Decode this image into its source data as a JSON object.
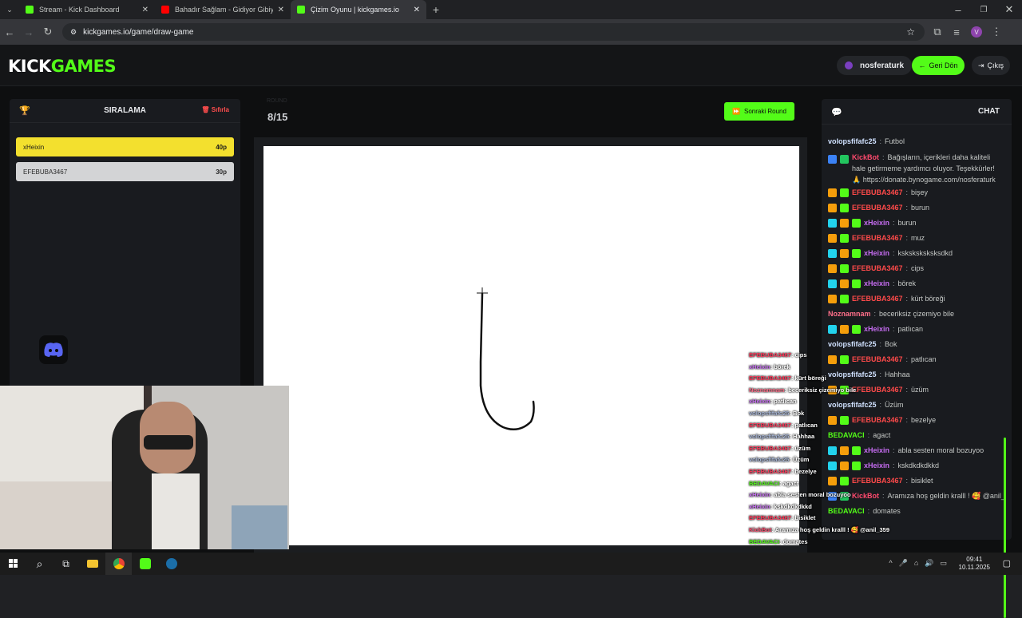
{
  "browser": {
    "tabs": [
      {
        "title": "Stream - Kick Dashboard",
        "color": "#53fc18"
      },
      {
        "title": "Bahadır Sağlam - Gidiyor Gibiyi",
        "color": "#ff0000"
      },
      {
        "title": "Çizim Oyunu | kickgames.io",
        "color": "#53fc18"
      }
    ],
    "url": "kickgames.io/game/draw-game",
    "profile_letter": "V"
  },
  "header": {
    "logo_kick": "KICK",
    "logo_games": "GAMES",
    "username": "nosferaturk",
    "back_label": "Geri Dön",
    "exit_label": "Çıkış"
  },
  "ranking": {
    "title": "SIRALAMA",
    "reset_label": "Sıfırla",
    "players": [
      {
        "name": "xHeixin",
        "points": "40p",
        "bg": "#f3e02e",
        "color": "#1a1a1a"
      },
      {
        "name": "EFEBUBA3467",
        "points": "30p",
        "bg": "#d3d4d6",
        "color": "#2a2a2a"
      }
    ]
  },
  "game": {
    "round_label": "ROUND",
    "round": "8/15",
    "next_round_label": "Sonraki Round"
  },
  "chat": {
    "title": "CHAT",
    "messages": [
      {
        "user": "volopsfifafc25",
        "text": "Futbol",
        "color": "#d0e1ff",
        "badges": []
      },
      {
        "user": "KickBot",
        "text": "Bağışların, içerikleri daha kaliteli hale getirmeme yardımcı oluyor. Teşekkürler! 🙏 https://donate.bynogame.com/nosferaturk",
        "color": "#ff4a6e",
        "badges": [
          "#3b82f6",
          "#22c55e"
        ]
      },
      {
        "user": "EFEBUBA3467",
        "text": "bişey",
        "color": "#ff4a4a",
        "badges": [
          "#f59e0b",
          "#53fc18"
        ]
      },
      {
        "user": "EFEBUBA3467",
        "text": "burun",
        "color": "#ff4a4a",
        "badges": [
          "#f59e0b",
          "#53fc18"
        ]
      },
      {
        "user": "xHeixin",
        "text": "burun",
        "color": "#c56cf0",
        "badges": [
          "#22d3ee",
          "#f59e0b",
          "#53fc18"
        ]
      },
      {
        "user": "EFEBUBA3467",
        "text": "muz",
        "color": "#ff4a4a",
        "badges": [
          "#f59e0b",
          "#53fc18"
        ]
      },
      {
        "user": "xHeixin",
        "text": "ksksksksksksdkd",
        "color": "#c56cf0",
        "badges": [
          "#22d3ee",
          "#f59e0b",
          "#53fc18"
        ]
      },
      {
        "user": "EFEBUBA3467",
        "text": "cips",
        "color": "#ff4a4a",
        "badges": [
          "#f59e0b",
          "#53fc18"
        ]
      },
      {
        "user": "xHeixin",
        "text": "börek",
        "color": "#c56cf0",
        "badges": [
          "#22d3ee",
          "#f59e0b",
          "#53fc18"
        ]
      },
      {
        "user": "EFEBUBA3467",
        "text": "kürt böreği",
        "color": "#ff4a4a",
        "badges": [
          "#f59e0b",
          "#53fc18"
        ]
      },
      {
        "user": "Noznamnam",
        "text": "beceriksiz çizemiyo bile",
        "color": "#ff6f8a",
        "badges": []
      },
      {
        "user": "xHeixin",
        "text": "patlıcan",
        "color": "#c56cf0",
        "badges": [
          "#22d3ee",
          "#f59e0b",
          "#53fc18"
        ]
      },
      {
        "user": "volopsfifafc25",
        "text": "Bok",
        "color": "#d0e1ff",
        "badges": []
      },
      {
        "user": "EFEBUBA3467",
        "text": "patlıcan",
        "color": "#ff4a4a",
        "badges": [
          "#f59e0b",
          "#53fc18"
        ]
      },
      {
        "user": "volopsfifafc25",
        "text": "Hahhaa",
        "color": "#d0e1ff",
        "badges": []
      },
      {
        "user": "EFEBUBA3467",
        "text": "üzüm",
        "color": "#ff4a4a",
        "badges": [
          "#f59e0b",
          "#53fc18"
        ]
      },
      {
        "user": "volopsfifafc25",
        "text": "Üzüm",
        "color": "#d0e1ff",
        "badges": []
      },
      {
        "user": "EFEBUBA3467",
        "text": "bezelye",
        "color": "#ff4a4a",
        "badges": [
          "#f59e0b",
          "#53fc18"
        ]
      },
      {
        "user": "BEDAVACI",
        "text": "agact",
        "color": "#53fc18",
        "badges": []
      },
      {
        "user": "xHeixin",
        "text": "abla sesten moral bozuyoo",
        "color": "#c56cf0",
        "badges": [
          "#22d3ee",
          "#f59e0b",
          "#53fc18"
        ]
      },
      {
        "user": "xHeixin",
        "text": "kskdkdkdkkd",
        "color": "#c56cf0",
        "badges": [
          "#22d3ee",
          "#f59e0b",
          "#53fc18"
        ]
      },
      {
        "user": "EFEBUBA3467",
        "text": "bisiklet",
        "color": "#ff4a4a",
        "badges": [
          "#f59e0b",
          "#53fc18"
        ]
      },
      {
        "user": "KickBot",
        "text": "Aramıza hoş geldin kralll ! 🥰 @anil_359",
        "color": "#ff4a6e",
        "badges": [
          "#3b82f6",
          "#22c55e"
        ]
      },
      {
        "user": "BEDAVACI",
        "text": "domates",
        "color": "#53fc18",
        "badges": []
      }
    ]
  },
  "overlay": {
    "messages": [
      {
        "user": "EFEBUBA3467",
        "text": "cips",
        "color": "#ff3b5c"
      },
      {
        "user": "xHeixin",
        "text": "börek",
        "color": "#c56cf0"
      },
      {
        "user": "EFEBUBA3467",
        "text": "kürt böreği",
        "color": "#ff3b5c"
      },
      {
        "user": "Noznamnam",
        "text": "beceriksiz çizemiyo bile",
        "color": "#ff6f8a"
      },
      {
        "user": "xHeixin",
        "text": "patlıcan",
        "color": "#c56cf0"
      },
      {
        "user": "volopsfifafc25",
        "text": "Bok",
        "color": "#a8b7d8"
      },
      {
        "user": "EFEBUBA3467",
        "text": "patlıcan",
        "color": "#ff3b5c"
      },
      {
        "user": "volopsfifafc25",
        "text": "Hahhaa",
        "color": "#a8b7d8"
      },
      {
        "user": "EFEBUBA3467",
        "text": "üzüm",
        "color": "#ff3b5c"
      },
      {
        "user": "volopsfifafc25",
        "text": "Üzüm",
        "color": "#a8b7d8"
      },
      {
        "user": "EFEBUBA3467",
        "text": "bezelye",
        "color": "#ff3b5c"
      },
      {
        "user": "BEDAVACI",
        "text": "agact",
        "color": "#53fc18"
      },
      {
        "user": "xHeixin",
        "text": "abla sesten moral bozuyoo",
        "color": "#c56cf0"
      },
      {
        "user": "xHeixin",
        "text": "kskdkdkdkkd",
        "color": "#c56cf0"
      },
      {
        "user": "EFEBUBA3467",
        "text": "bisiklet",
        "color": "#ff3b5c"
      },
      {
        "user": "KickBot",
        "text": "Aramıza hoş geldin kralll ! 🥰 @anil_359",
        "color": "#ff4a6e"
      },
      {
        "user": "BEDAVACI",
        "text": "domates",
        "color": "#53fc18"
      }
    ]
  },
  "taskbar": {
    "time": "09:41",
    "date": "10.11.2025"
  }
}
